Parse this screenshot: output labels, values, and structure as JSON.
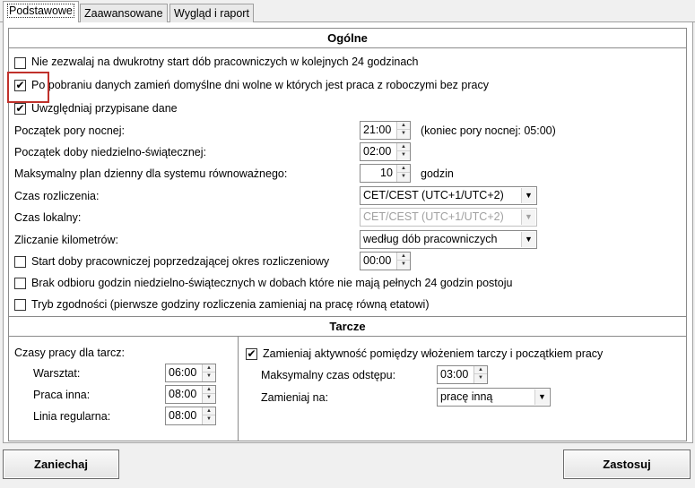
{
  "tabs": [
    {
      "label": "Podstawowe"
    },
    {
      "label": "Zaawansowane"
    },
    {
      "label": "Wygląd i raport"
    }
  ],
  "general": {
    "title": "Ogólne",
    "checkbox_no_double_start": {
      "label": "Nie zezwalaj na dwukrotny start dób pracowniczych w kolejnych 24 godzinach",
      "checked": false
    },
    "checkbox_replace_days_off": {
      "label": "Po pobraniu danych zamień domyślne dni wolne w których jest praca z roboczymi bez pracy",
      "checked": true
    },
    "checkbox_assigned_data": {
      "label": "Uwzględniaj przypisane dane",
      "checked": true
    },
    "night_start": {
      "label": "Początek pory nocnej:",
      "value": "21:00",
      "note": "(koniec pory nocnej: 05:00)"
    },
    "sunday_start": {
      "label": "Początek doby niedzielno-świątecznej:",
      "value": "02:00"
    },
    "max_daily_plan": {
      "label": "Maksymalny plan dzienny dla systemu równoważnego:",
      "value": "10",
      "unit": "godzin"
    },
    "settlement_time": {
      "label": "Czas rozliczenia:",
      "value": "CET/CEST (UTC+1/UTC+2)"
    },
    "local_time": {
      "label": "Czas lokalny:",
      "value": "CET/CEST (UTC+1/UTC+2)"
    },
    "km_counting": {
      "label": "Zliczanie kilometrów:",
      "value": "według dób pracowniczych"
    },
    "checkbox_preceding_day": {
      "label": "Start doby pracowniczej poprzedzającej okres rozliczeniowy",
      "checked": false,
      "value": "00:00"
    },
    "checkbox_no_sunday_pickup": {
      "label": "Brak odbioru godzin niedzielno-świątecznych w dobach które nie mają pełnych 24 godzin postoju",
      "checked": false
    },
    "checkbox_compliance": {
      "label": "Tryb zgodności (pierwsze godziny rozliczenia zamieniaj na pracę równą etatowi)",
      "checked": false
    }
  },
  "discs": {
    "title": "Tarcze",
    "work_times_label": "Czasy pracy dla tarcz:",
    "workshop": {
      "label": "Warsztat:",
      "value": "06:00"
    },
    "other_work": {
      "label": "Praca inna:",
      "value": "08:00"
    },
    "regular_line": {
      "label": "Linia regularna:",
      "value": "08:00"
    },
    "checkbox_replace_activity": {
      "label": "Zamieniaj aktywność pomiędzy włożeniem tarczy i początkiem pracy",
      "checked": true
    },
    "max_gap": {
      "label": "Maksymalny czas odstępu:",
      "value": "03:00"
    },
    "replace_with": {
      "label": "Zamieniaj na:",
      "value": "pracę inną"
    }
  },
  "footer": {
    "cancel_label": "Zaniechaj",
    "apply_label": "Zastosuj"
  },
  "glyphs": {
    "check": "✔",
    "up": "▲",
    "down": "▼"
  },
  "colors": {
    "highlight": "#c0312b"
  }
}
